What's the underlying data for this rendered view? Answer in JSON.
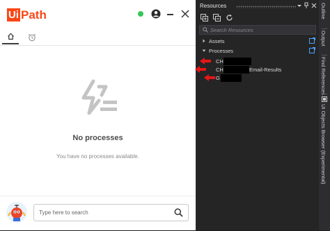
{
  "assistant": {
    "logo": {
      "box_text": "Ui",
      "text": "Path"
    },
    "status_color": "#34c759",
    "brand_color": "#fa4616",
    "tabs": [
      {
        "name": "home",
        "icon": "home-icon"
      },
      {
        "name": "alarm",
        "icon": "alarm-clock-icon"
      }
    ],
    "empty_state": {
      "icon": "no-processes-icon",
      "title": "No processes",
      "subtitle": "You have no processes available."
    },
    "search": {
      "placeholder": "Type here to search"
    }
  },
  "resources_panel": {
    "title": "Resources",
    "search_placeholder": "Search Resources",
    "tree": [
      {
        "label": "Assets",
        "expanded": false
      },
      {
        "label": "Processes",
        "expanded": true
      }
    ],
    "processes": [
      {
        "prefix": "CH",
        "suffix": ""
      },
      {
        "prefix": "CH",
        "suffix": "Email-Results"
      },
      {
        "prefix": "G",
        "suffix": ""
      }
    ]
  },
  "side_tabs": [
    "Outline",
    "Output",
    "Find References",
    "UI Objects Browser (Experimental)"
  ]
}
